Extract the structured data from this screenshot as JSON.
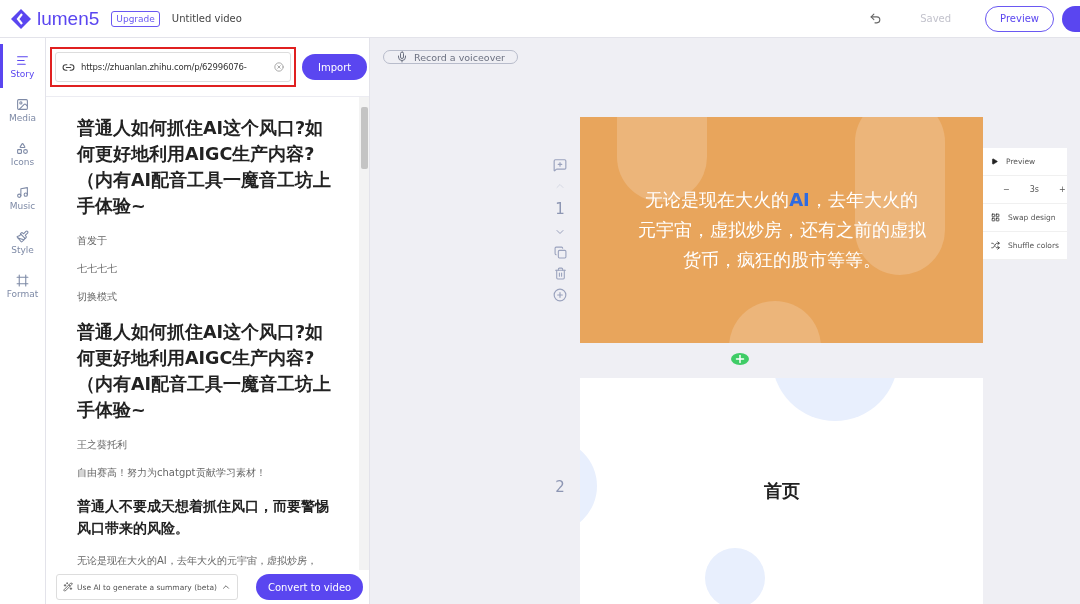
{
  "header": {
    "logo": "lumen5",
    "upgrade": "Upgrade",
    "title": "Untitled video",
    "saved": "Saved",
    "preview": "Preview"
  },
  "rail": [
    {
      "label": "Story",
      "selected": true
    },
    {
      "label": "Media",
      "selected": false
    },
    {
      "label": "Icons",
      "selected": false
    },
    {
      "label": "Music",
      "selected": false
    },
    {
      "label": "Style",
      "selected": false
    },
    {
      "label": "Format",
      "selected": false
    }
  ],
  "url_field": {
    "value": "https://zhuanlan.zhihu.com/p/62996076-",
    "highlighted": true
  },
  "import_button": "Import",
  "story": [
    {
      "kind": "heading",
      "text": "普通人如何抓住AI这个风口?如何更好地利用AIGC生产内容?（内有AI配音工具一魔音工坊上手体验~"
    },
    {
      "kind": "text",
      "text": "首发于"
    },
    {
      "kind": "text",
      "text": "七七七七"
    },
    {
      "kind": "text",
      "text": "切换模式"
    },
    {
      "kind": "heading",
      "text": "普通人如何抓住AI这个风口?如何更好地利用AIGC生产内容?（内有AI配音工具一魔音工坊上手体验~"
    },
    {
      "kind": "text",
      "text": "王之葵托利"
    },
    {
      "kind": "text",
      "text": "自由赛高！努力为chatgpt贡献学习素材！"
    },
    {
      "kind": "subheading",
      "text": "普通人不要成天想着抓住风口，而要警惕风口带来的风险。"
    },
    {
      "kind": "text",
      "text": "无论是现在大火的AI，去年大火的元宇宙，虚拟炒房，"
    }
  ],
  "summary_dropdown": "Use AI to generate a summary (beta)",
  "convert_button": "Convert to video",
  "voiceover_button": "Record a voiceover",
  "slides": [
    {
      "number": "1",
      "kind": "orange",
      "text": "无论是现在大火的**AI**，去年大火的元宇宙，虚拟炒房，还有之前的虚拟货币，疯狂的股市等等。"
    },
    {
      "number": "2",
      "kind": "white",
      "text": "首页"
    }
  ],
  "slide_menu": {
    "preview": "Preview",
    "minus": "−",
    "duration": "3s",
    "plus": "+",
    "swap": "Swap design",
    "shuffle": "Shuffle colors"
  }
}
